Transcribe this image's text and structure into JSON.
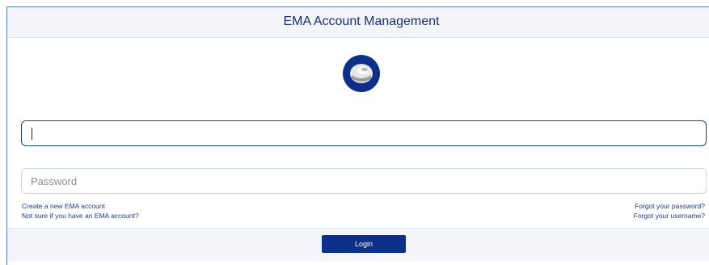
{
  "header": {
    "title": "EMA Account Management"
  },
  "logo": {
    "icon": "ema-logo-icon",
    "colors": {
      "outer": "#0d2f8a",
      "inner": "#d8d8d8"
    }
  },
  "form": {
    "username": {
      "value": "",
      "placeholder": ""
    },
    "password": {
      "value": "",
      "placeholder": "Password"
    },
    "links": {
      "create_account": "Create a new EMA account",
      "not_sure": "Not sure if you have an EMA account?",
      "forgot_password": "Forgot your password?",
      "forgot_username": "Forgot your username?"
    },
    "login_label": "Login"
  },
  "colors": {
    "accent": "#0d2f8a",
    "header_text": "#1a2f74",
    "header_bg": "#f3f5fa",
    "link": "#1c3a8e"
  }
}
